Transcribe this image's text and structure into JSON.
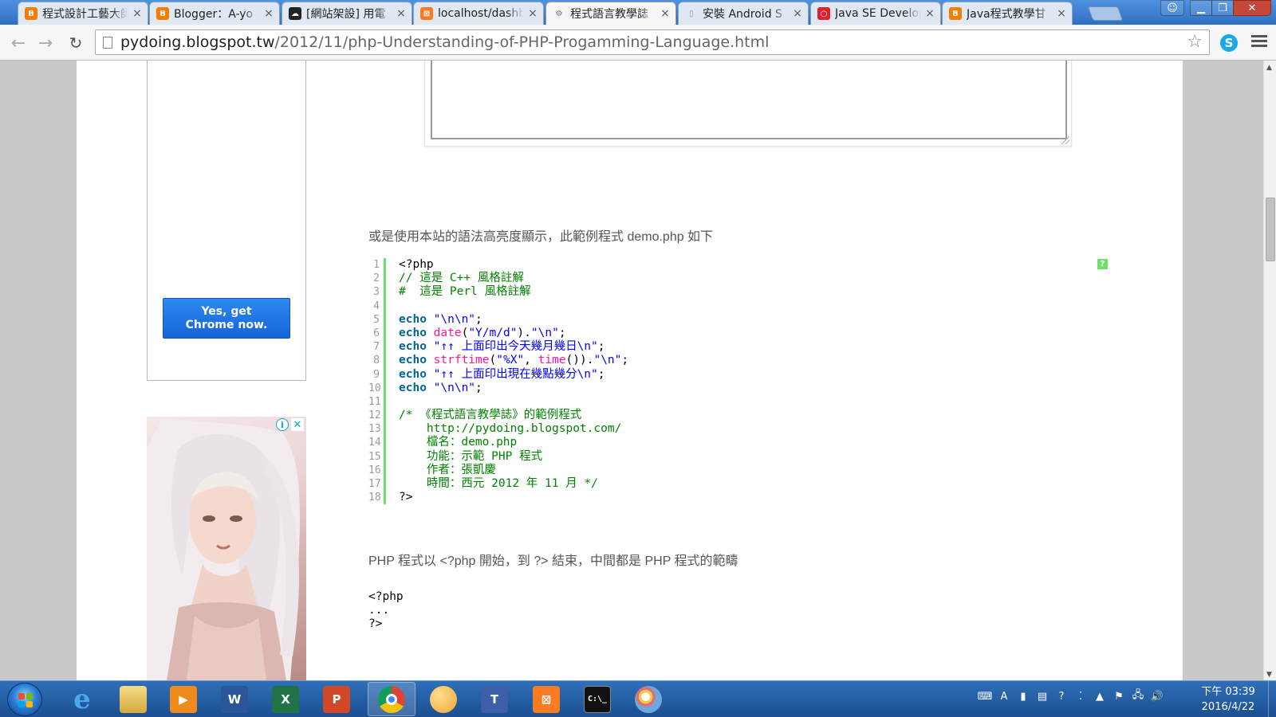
{
  "browser": {
    "tabs": [
      {
        "title": "程式設計工藝大師",
        "favicon": "blogger-icon",
        "color": "#f57d00",
        "active": false
      },
      {
        "title": "Blogger：A-yo",
        "favicon": "blogger-icon",
        "color": "#f57d00",
        "active": false
      },
      {
        "title": "[網站架設] 用電",
        "favicon": "cloud-icon",
        "color": "#222222",
        "active": false
      },
      {
        "title": "localhost/dashboard",
        "favicon": "xampp-icon",
        "color": "#fb7a24",
        "active": false
      },
      {
        "title": "程式語言教學誌",
        "favicon": "gear-icon",
        "color": "#777777",
        "active": true
      },
      {
        "title": "安裝 Android S",
        "favicon": "page-icon",
        "color": "#999999",
        "active": false
      },
      {
        "title": "Java SE Develop",
        "favicon": "oracle-icon",
        "color": "#e0202e",
        "active": false
      },
      {
        "title": "Java程式教學甘",
        "favicon": "blogger-icon",
        "color": "#f57d00",
        "active": false
      }
    ],
    "url_host": "pydoing.blogspot.tw",
    "url_path": "/2012/11/php-Understanding-of-PHP-Progamming-Language.html"
  },
  "sidebar": {
    "chrome_button_line1": "Yes, get",
    "chrome_button_line2": "Chrome now."
  },
  "article": {
    "intro": "或是使用本站的語法高亮度顯示，此範例程式 demo.php 如下",
    "code_help": "?",
    "code_lines": [
      "<span>&lt;?php</span>",
      "<span class=\"c\">// 這是 C++ 風格註解</span>",
      "<span class=\"c\">#  這是 Perl 風格註解</span>",
      "",
      "<span class=\"k\">echo</span> <span class=\"s\">\"\\n\\n\"</span>;",
      "<span class=\"k\">echo</span> <span class=\"f\">date</span>(<span class=\"s\">\"Y/m/d\"</span>).<span class=\"s\">\"\\n\"</span>;",
      "<span class=\"k\">echo</span> <span class=\"s\">\"↑↑ 上面印出今天幾月幾日\\n\"</span>;",
      "<span class=\"k\">echo</span> <span class=\"f\">strftime</span>(<span class=\"s\">\"%X\"</span>, <span class=\"f\">time</span>()).<span class=\"s\">\"\\n\"</span>;",
      "<span class=\"k\">echo</span> <span class=\"s\">\"↑↑ 上面印出現在幾點幾分\\n\"</span>;",
      "<span class=\"k\">echo</span> <span class=\"s\">\"\\n\\n\"</span>;",
      "",
      "<span class=\"c\">/* 《程式語言教學誌》的範例程式</span>",
      "<span class=\"c\">    http://pydoing.blogspot.com/</span>",
      "<span class=\"c\">    檔名：demo.php</span>",
      "<span class=\"c\">    功能：示範 PHP 程式</span>",
      "<span class=\"c\">    作者：張凱慶</span>",
      "<span class=\"c\">    時間：西元 2012 年 11 月 */</span>",
      "<span>?&gt;</span>"
    ],
    "outro": "PHP 程式以 <?php 開始，到 ?> 結束，中間都是 PHP 程式的範疇",
    "plain_code": "<?php\n...\n?>"
  },
  "taskbar": {
    "apps": [
      {
        "name": "ie-icon",
        "label": "e",
        "color": "#2a8ee6"
      },
      {
        "name": "file-explorer-icon",
        "label": "",
        "color": "#e8c15a"
      },
      {
        "name": "media-player-icon",
        "label": "▶",
        "color": "#f08a1c"
      },
      {
        "name": "word-icon",
        "label": "W",
        "color": "#2b579a"
      },
      {
        "name": "excel-icon",
        "label": "X",
        "color": "#217346"
      },
      {
        "name": "powerpoint-icon",
        "label": "P",
        "color": "#d24726"
      },
      {
        "name": "chrome-icon",
        "label": "",
        "color": "#ffffff"
      },
      {
        "name": "paint-net-icon",
        "label": "",
        "color": "#f0c048"
      },
      {
        "name": "text-editor-icon",
        "label": "T",
        "color": "#3d5ea8"
      },
      {
        "name": "xampp-icon",
        "label": "⊠",
        "color": "#fb7a24"
      },
      {
        "name": "cmd-icon",
        "label": "C:\\_",
        "color": "#111111"
      },
      {
        "name": "paint-icon",
        "label": "",
        "color": "#6fa8dc"
      }
    ],
    "clock_time": "下午 03:39",
    "clock_date": "2016/4/22"
  }
}
